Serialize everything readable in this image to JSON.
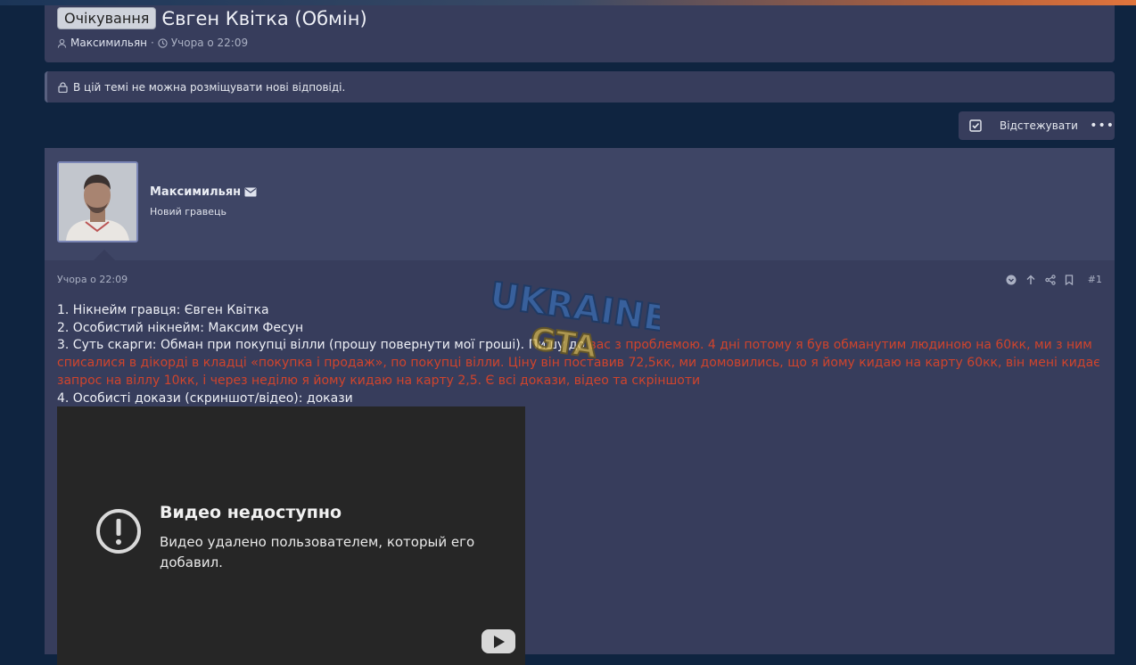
{
  "thread": {
    "status_badge": "Очікування",
    "title": "Євген Квітка (Обмін)",
    "author": "Максимильян",
    "separator": "·",
    "time": "Учора о 22:09"
  },
  "notice": {
    "text": "В цій темі не можна розміщувати нові відповіді."
  },
  "actions": {
    "watch_label": "Відстежувати",
    "more_label": "•••"
  },
  "post": {
    "username": "Максимильян",
    "user_title": "Новий гравець",
    "date": "Учора о 22:09",
    "number": "#1",
    "lines": {
      "l1": "1. Нікнейм гравця: Євген Квітка",
      "l2": "2. Особистий нікнейм: Максим Фесун",
      "l3_black": "3. Суть скарги: Обман при покупці вілли (прошу повернути мої гроші). Пишу до",
      "l3_red": " вас з проблемою. 4 дні потому я був обманутим людиною на 60кк, ми з ним списалися в дікорді в кладці «покупка і продаж», по покупці вілли. Ціну він поставив 72,5кк, ми домовились, що я йому кидаю на карту 60кк, він мені кидає запрос на віллу 10кк, і через неділю я йому кидаю на карту 2,5. Є всі докази, відео та скріншоти",
      "l4": "4. Особисті докази (скриншот/відео): докази"
    }
  },
  "video": {
    "title": "Видео недоступно",
    "description": "Видео удалено пользователем, который его добавил."
  },
  "watermark": {
    "line1": "UKRAINE",
    "line2": "GTA"
  },
  "colors": {
    "accent_red": "#d0442c",
    "panel": "#373d5c",
    "background": "#0f2440"
  },
  "icons": [
    "user-icon",
    "clock-icon",
    "lock-icon",
    "checkbox-icon",
    "envelope-icon",
    "react-icon",
    "arrow-up-icon",
    "share-icon",
    "bookmark-icon",
    "alert-icon",
    "youtube-play-icon"
  ]
}
